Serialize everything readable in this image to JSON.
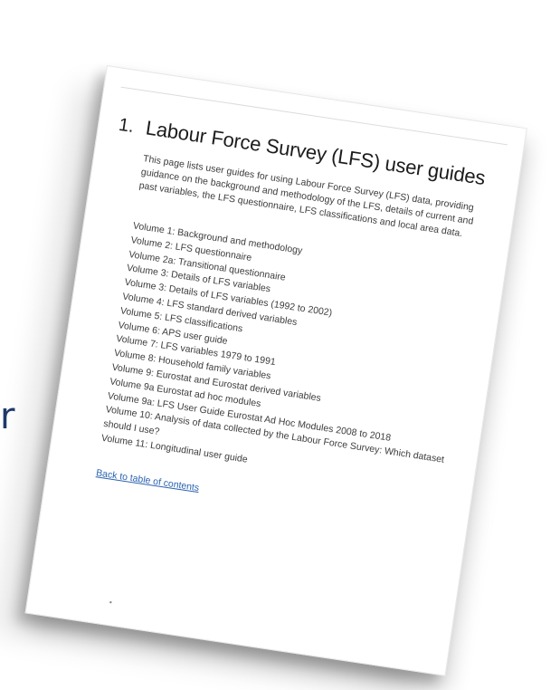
{
  "background": {
    "partial_letter": "r"
  },
  "page": {
    "section_number": "1.",
    "title": "Labour Force Survey (LFS) user guides",
    "intro": "This page lists user guides for using Labour Force Survey (LFS) data, providing guidance on the background and methodology of the LFS, details of current and past variables, the LFS questionnaire, LFS classifications and local area data.",
    "volumes": [
      "Volume 1: Background and methodology",
      "Volume 2: LFS questionnaire",
      "Volume 2a: Transitional questionnaire",
      "Volume 3: Details of LFS variables",
      "Volume 3: Details of LFS variables (1992 to 2002)",
      "Volume 4: LFS standard derived variables",
      "Volume 5: LFS classifications",
      "Volume 6: APS user guide",
      "Volume 7: LFS variables 1979 to 1991",
      "Volume 8: Household family variables",
      "Volume 9: Eurostat and Eurostat derived variables",
      "Volume 9a Eurostat ad hoc modules",
      "Volume 9a: LFS User Guide Eurostat Ad Hoc Modules 2008 to 2018",
      "Volume 10: Analysis of data collected by the Labour Force Survey: Which dataset should I use?",
      "Volume 11: Longitudinal user guide"
    ],
    "back_link": "Back to table of contents"
  },
  "colors": {
    "link": "#2a62b0",
    "background_letter": "#1f3a6b",
    "text": "#3c3c3c"
  }
}
